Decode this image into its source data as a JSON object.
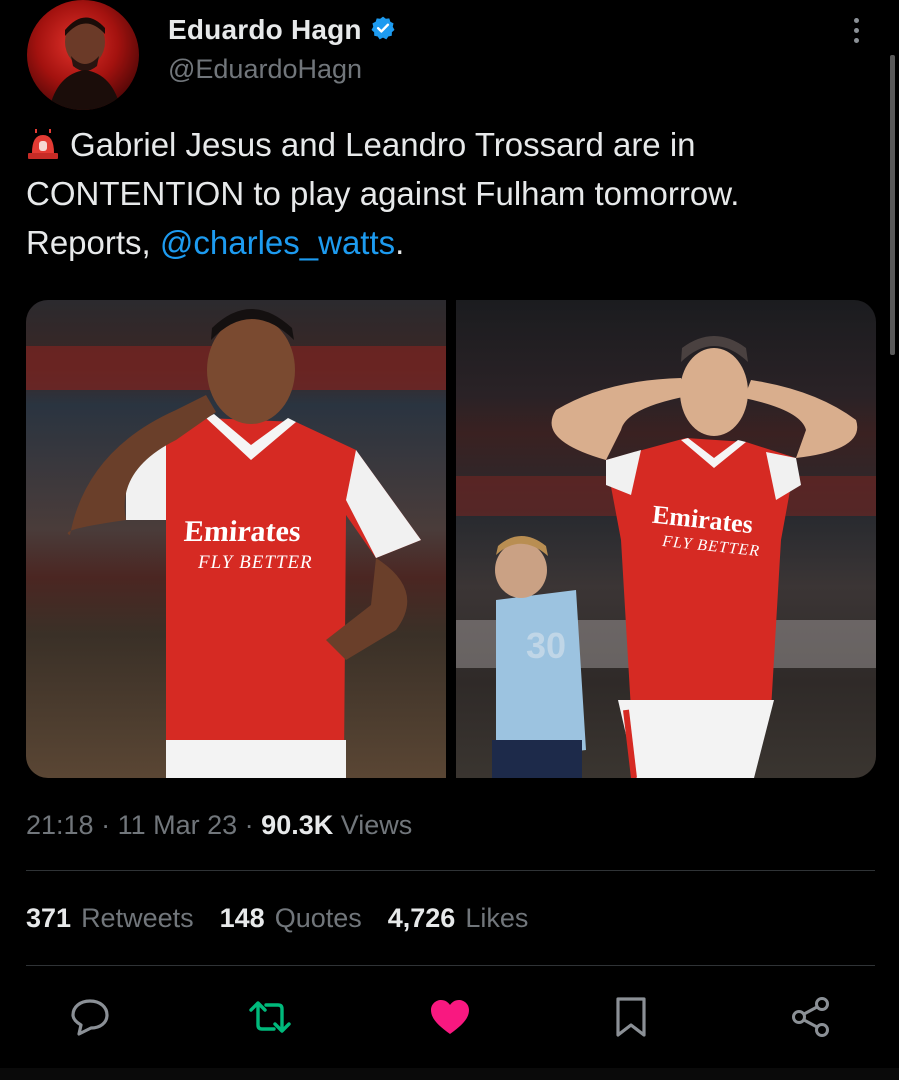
{
  "author": {
    "display_name": "Eduardo Hagn",
    "handle": "@EduardoHagn",
    "verified": true
  },
  "tweet": {
    "emoji": "siren-icon",
    "text_part1": "Gabriel Jesus and Leandro Trossard are in CONTENTION to play against Fulham tomorrow. Reports, ",
    "mention": "@charles_watts",
    "text_part2": ".",
    "time": "21:18",
    "date": "11 Mar 23",
    "views_count": "90.3K",
    "views_label": "Views"
  },
  "media": {
    "photo1": {
      "sponsor": "Emirates",
      "tagline": "FLY BETTER"
    },
    "photo2": {
      "sponsor": "Emirates",
      "tagline": "FLY BETTER",
      "shirt_number": "30"
    }
  },
  "stats": {
    "retweets_count": "371",
    "retweets_label": "Retweets",
    "quotes_count": "148",
    "quotes_label": "Quotes",
    "likes_count": "4,726",
    "likes_label": "Likes"
  },
  "colors": {
    "background": "#000000",
    "accent": "#1d9bf0",
    "retweet": "#00ba7c",
    "like": "#f91880",
    "muted": "#71767b",
    "text": "#e7e9ea"
  },
  "icons": [
    "more-icon",
    "verified-badge-icon",
    "reply-icon",
    "retweet-icon",
    "like-icon",
    "bookmark-icon",
    "share-icon"
  ]
}
